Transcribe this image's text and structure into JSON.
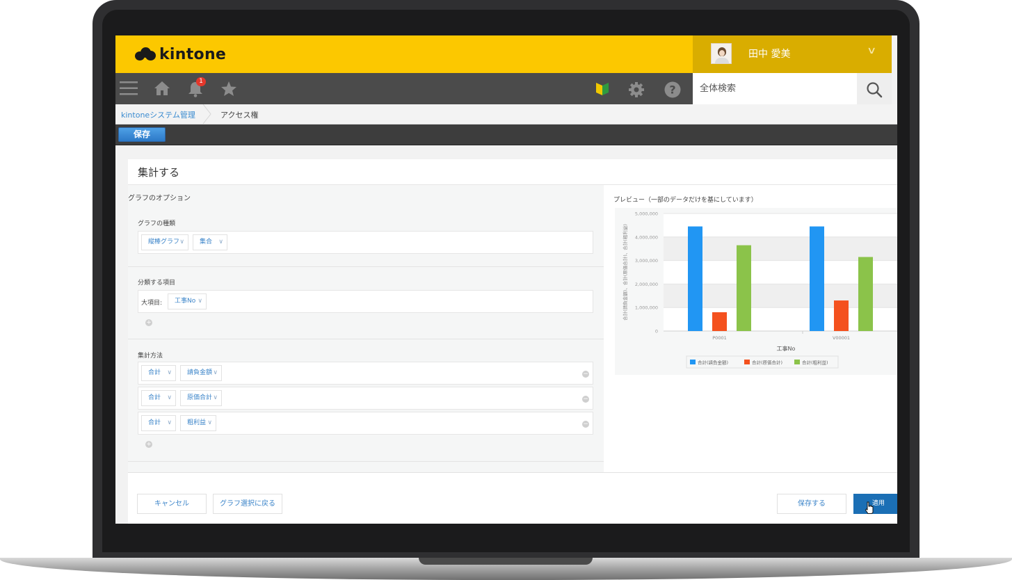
{
  "header": {
    "logo_text": "kintone",
    "user_name": "田中 愛美",
    "notification_count": "1",
    "search_placeholder": "全体検索"
  },
  "breadcrumb": {
    "items": [
      "kintoneシステム管理",
      "アクセス権"
    ]
  },
  "toolbar": {
    "save_label": "保存"
  },
  "panel": {
    "title": "集計する",
    "options_heading": "グラフのオプション",
    "graph_type": {
      "label": "グラフの種類",
      "type_value": "縦棒グラフ",
      "mode_value": "集合"
    },
    "classification": {
      "label": "分類する項目",
      "major_label": "大項目:",
      "major_value": "工事No"
    },
    "aggregation": {
      "label": "集計方法",
      "rows": [
        {
          "func": "合計",
          "field": "請負金額"
        },
        {
          "func": "合計",
          "field": "原価合計"
        },
        {
          "func": "合計",
          "field": "粗利益"
        }
      ]
    },
    "preview_label": "プレビュー（一部のデータだけを基にしています）",
    "footer": {
      "cancel": "キャンセル",
      "back": "グラフ選択に戻る",
      "save": "保存する",
      "apply": "適用"
    }
  },
  "chart_data": {
    "type": "bar",
    "categories": [
      "P0001",
      "V00001"
    ],
    "series": [
      {
        "name": "合計(請負金額)",
        "values": [
          4450000,
          4450000
        ],
        "color": "#2196f3"
      },
      {
        "name": "合計(原価合計)",
        "values": [
          800000,
          1300000
        ],
        "color": "#f4511e"
      },
      {
        "name": "合計(粗利益)",
        "values": [
          3650000,
          3150000
        ],
        "color": "#8bc34a"
      }
    ],
    "xlabel": "工事No",
    "ylabel": "合計(請負金額)、合計(原価合計)、合計(粗利益)",
    "yticks": [
      "0",
      "1,000,000",
      "2,000,000",
      "3,000,000",
      "4,000,000",
      "5,000,000"
    ],
    "ylim": [
      0,
      5000000
    ],
    "grid": true,
    "legend": "bottom"
  }
}
